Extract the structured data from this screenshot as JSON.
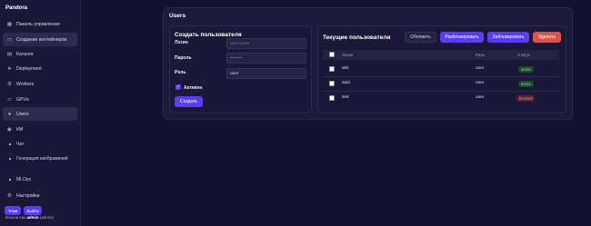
{
  "app": {
    "brand": "Pandora"
  },
  "sidebar": {
    "items": [
      {
        "label": "Панель управления",
        "icon": "dashboard-icon"
      },
      {
        "label": "Создание контейнеров",
        "icon": "container-icon"
      },
      {
        "label": "Каталог",
        "icon": "catalog-icon"
      },
      {
        "label": "Deployment",
        "icon": "rocket-icon"
      },
      {
        "label": "Workers",
        "icon": "workers-icon"
      },
      {
        "label": "GPUs",
        "icon": "gpu-icon"
      },
      {
        "label": "Users",
        "icon": "user-icon"
      },
      {
        "label": "ИИ",
        "icon": "ai-icon"
      },
      {
        "label": "Настройки",
        "icon": "gear-icon"
      }
    ],
    "ai_sub": [
      {
        "label": "Чат"
      },
      {
        "label": "Генерация изображений"
      },
      {
        "label": "MLOps"
      }
    ],
    "buttons": {
      "theme": "Тема",
      "logout": "Выйти"
    },
    "footer": {
      "prefix": "Вошли как",
      "user": "admin",
      "role": "(admin)"
    }
  },
  "page": {
    "title": "Users"
  },
  "create_form": {
    "title": "Создать пользователя",
    "login_label": "Логин",
    "login_placeholder": "username",
    "password_label": "Пароль",
    "password_placeholder": "••••••••",
    "role_label": "Роль",
    "role_value": "user",
    "active_label": "Активен",
    "active_checked": true,
    "submit_label": "Создать"
  },
  "users_panel": {
    "title": "Текущие пользователи",
    "buttons": {
      "refresh": "Обновить",
      "unblock": "Разблокировать",
      "block": "Заблокировать",
      "delete": "Удалить"
    },
    "columns": [
      "",
      "Логин",
      "Роль",
      "Статус"
    ],
    "rows": [
      {
        "login": "abk",
        "role": "user",
        "status": "active"
      },
      {
        "login": "said",
        "role": "user",
        "status": "active"
      },
      {
        "login": "test",
        "role": "user",
        "status": "blocked"
      }
    ]
  },
  "colors": {
    "accent": "#5b3df0",
    "danger": "#d9534f",
    "active": "#6fe39a",
    "blocked": "#f08b9c"
  }
}
